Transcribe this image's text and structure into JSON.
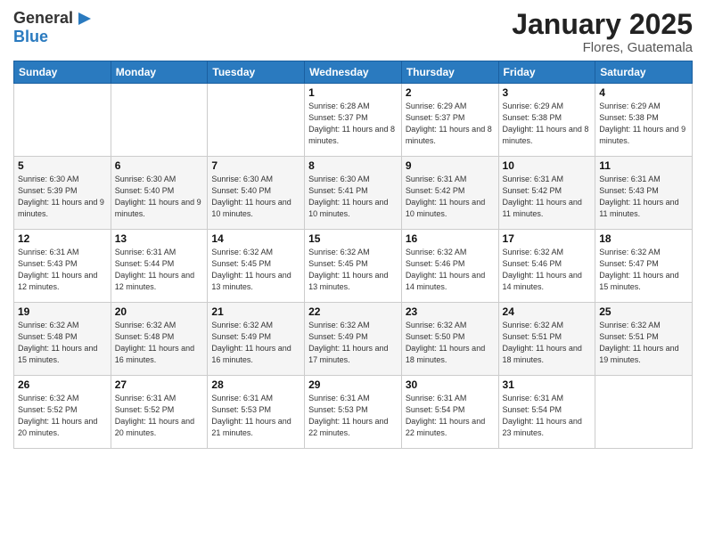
{
  "logo": {
    "line1": "General",
    "line2": "Blue",
    "icon": "▶"
  },
  "header": {
    "month_year": "January 2025",
    "location": "Flores, Guatemala"
  },
  "days_of_week": [
    "Sunday",
    "Monday",
    "Tuesday",
    "Wednesday",
    "Thursday",
    "Friday",
    "Saturday"
  ],
  "weeks": [
    [
      {
        "num": "",
        "sunrise": "",
        "sunset": "",
        "daylight": ""
      },
      {
        "num": "",
        "sunrise": "",
        "sunset": "",
        "daylight": ""
      },
      {
        "num": "",
        "sunrise": "",
        "sunset": "",
        "daylight": ""
      },
      {
        "num": "1",
        "sunrise": "6:28 AM",
        "sunset": "5:37 PM",
        "daylight": "11 hours and 8 minutes."
      },
      {
        "num": "2",
        "sunrise": "6:29 AM",
        "sunset": "5:37 PM",
        "daylight": "11 hours and 8 minutes."
      },
      {
        "num": "3",
        "sunrise": "6:29 AM",
        "sunset": "5:38 PM",
        "daylight": "11 hours and 8 minutes."
      },
      {
        "num": "4",
        "sunrise": "6:29 AM",
        "sunset": "5:38 PM",
        "daylight": "11 hours and 9 minutes."
      }
    ],
    [
      {
        "num": "5",
        "sunrise": "6:30 AM",
        "sunset": "5:39 PM",
        "daylight": "11 hours and 9 minutes."
      },
      {
        "num": "6",
        "sunrise": "6:30 AM",
        "sunset": "5:40 PM",
        "daylight": "11 hours and 9 minutes."
      },
      {
        "num": "7",
        "sunrise": "6:30 AM",
        "sunset": "5:40 PM",
        "daylight": "11 hours and 10 minutes."
      },
      {
        "num": "8",
        "sunrise": "6:30 AM",
        "sunset": "5:41 PM",
        "daylight": "11 hours and 10 minutes."
      },
      {
        "num": "9",
        "sunrise": "6:31 AM",
        "sunset": "5:42 PM",
        "daylight": "11 hours and 10 minutes."
      },
      {
        "num": "10",
        "sunrise": "6:31 AM",
        "sunset": "5:42 PM",
        "daylight": "11 hours and 11 minutes."
      },
      {
        "num": "11",
        "sunrise": "6:31 AM",
        "sunset": "5:43 PM",
        "daylight": "11 hours and 11 minutes."
      }
    ],
    [
      {
        "num": "12",
        "sunrise": "6:31 AM",
        "sunset": "5:43 PM",
        "daylight": "11 hours and 12 minutes."
      },
      {
        "num": "13",
        "sunrise": "6:31 AM",
        "sunset": "5:44 PM",
        "daylight": "11 hours and 12 minutes."
      },
      {
        "num": "14",
        "sunrise": "6:32 AM",
        "sunset": "5:45 PM",
        "daylight": "11 hours and 13 minutes."
      },
      {
        "num": "15",
        "sunrise": "6:32 AM",
        "sunset": "5:45 PM",
        "daylight": "11 hours and 13 minutes."
      },
      {
        "num": "16",
        "sunrise": "6:32 AM",
        "sunset": "5:46 PM",
        "daylight": "11 hours and 14 minutes."
      },
      {
        "num": "17",
        "sunrise": "6:32 AM",
        "sunset": "5:46 PM",
        "daylight": "11 hours and 14 minutes."
      },
      {
        "num": "18",
        "sunrise": "6:32 AM",
        "sunset": "5:47 PM",
        "daylight": "11 hours and 15 minutes."
      }
    ],
    [
      {
        "num": "19",
        "sunrise": "6:32 AM",
        "sunset": "5:48 PM",
        "daylight": "11 hours and 15 minutes."
      },
      {
        "num": "20",
        "sunrise": "6:32 AM",
        "sunset": "5:48 PM",
        "daylight": "11 hours and 16 minutes."
      },
      {
        "num": "21",
        "sunrise": "6:32 AM",
        "sunset": "5:49 PM",
        "daylight": "11 hours and 16 minutes."
      },
      {
        "num": "22",
        "sunrise": "6:32 AM",
        "sunset": "5:49 PM",
        "daylight": "11 hours and 17 minutes."
      },
      {
        "num": "23",
        "sunrise": "6:32 AM",
        "sunset": "5:50 PM",
        "daylight": "11 hours and 18 minutes."
      },
      {
        "num": "24",
        "sunrise": "6:32 AM",
        "sunset": "5:51 PM",
        "daylight": "11 hours and 18 minutes."
      },
      {
        "num": "25",
        "sunrise": "6:32 AM",
        "sunset": "5:51 PM",
        "daylight": "11 hours and 19 minutes."
      }
    ],
    [
      {
        "num": "26",
        "sunrise": "6:32 AM",
        "sunset": "5:52 PM",
        "daylight": "11 hours and 20 minutes."
      },
      {
        "num": "27",
        "sunrise": "6:31 AM",
        "sunset": "5:52 PM",
        "daylight": "11 hours and 20 minutes."
      },
      {
        "num": "28",
        "sunrise": "6:31 AM",
        "sunset": "5:53 PM",
        "daylight": "11 hours and 21 minutes."
      },
      {
        "num": "29",
        "sunrise": "6:31 AM",
        "sunset": "5:53 PM",
        "daylight": "11 hours and 22 minutes."
      },
      {
        "num": "30",
        "sunrise": "6:31 AM",
        "sunset": "5:54 PM",
        "daylight": "11 hours and 22 minutes."
      },
      {
        "num": "31",
        "sunrise": "6:31 AM",
        "sunset": "5:54 PM",
        "daylight": "11 hours and 23 minutes."
      },
      {
        "num": "",
        "sunrise": "",
        "sunset": "",
        "daylight": ""
      }
    ]
  ]
}
